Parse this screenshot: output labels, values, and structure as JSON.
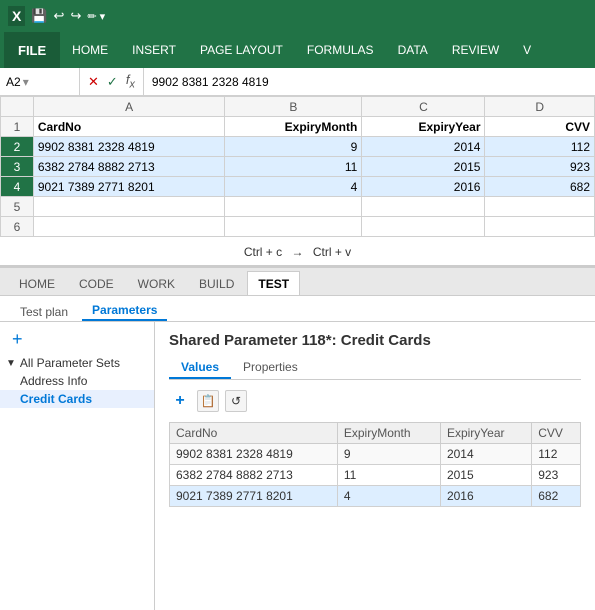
{
  "excel": {
    "toolbar_icons": [
      "save",
      "undo",
      "redo",
      "more"
    ],
    "ribbon_tabs": [
      "FILE",
      "HOME",
      "INSERT",
      "PAGE LAYOUT",
      "FORMULAS",
      "DATA",
      "REVIEW",
      "V"
    ],
    "cell_ref": "A2",
    "formula_value": "9902 8381 2328 4819",
    "columns": [
      "A",
      "B",
      "C",
      "D"
    ],
    "col_headers": [
      "CardNo",
      "ExpiryMonth",
      "ExpiryYear",
      "CVV"
    ],
    "rows": [
      {
        "row": "2",
        "a": "9902 8381 2328 4819",
        "b": "9",
        "c": "2014",
        "d": "112",
        "selected": true
      },
      {
        "row": "3",
        "a": "6382 2784 8882 2713",
        "b": "11",
        "c": "2015",
        "d": "923",
        "selected": true
      },
      {
        "row": "4",
        "a": "9021 7389 2771 8201",
        "b": "4",
        "c": "2016",
        "d": "682",
        "selected": true
      }
    ],
    "empty_rows": [
      "5",
      "6"
    ]
  },
  "copy_hint": {
    "text1": "Ctrl + c",
    "arrow": "→",
    "text2": "Ctrl + v"
  },
  "ide": {
    "main_tabs": [
      "HOME",
      "CODE",
      "WORK",
      "BUILD",
      "TEST"
    ],
    "active_main_tab": "TEST",
    "sub_tabs": [
      "Test plan",
      "Parameters"
    ],
    "active_sub_tab": "Parameters",
    "sidebar": {
      "add_label": "+",
      "group_label": "All Parameter Sets",
      "items": [
        "Address Info",
        "Credit Cards"
      ],
      "active_item": "Credit Cards"
    },
    "main_title": "Shared Parameter 118*: Credit Cards",
    "content_tabs": [
      "Values",
      "Properties"
    ],
    "active_content_tab": "Values",
    "toolbar_buttons": [
      "+",
      "📋",
      "↺"
    ],
    "table": {
      "headers": [
        "CardNo",
        "ExpiryMonth",
        "ExpiryYear",
        "CVV"
      ],
      "rows": [
        {
          "cardno": "9902 8381 2328 4819",
          "expiry_month": "9",
          "expiry_year": "2014",
          "cvv": "112"
        },
        {
          "cardno": "6382 2784 8882 2713",
          "expiry_month": "11",
          "expiry_year": "2015",
          "cvv": "923"
        },
        {
          "cardno": "9021 7389 2771 8201",
          "expiry_month": "4",
          "expiry_year": "2016",
          "cvv": "682"
        }
      ]
    }
  },
  "colors": {
    "excel_green": "#217346",
    "link_blue": "#0078d7",
    "selected_row_bg": "#DDEEFF"
  }
}
